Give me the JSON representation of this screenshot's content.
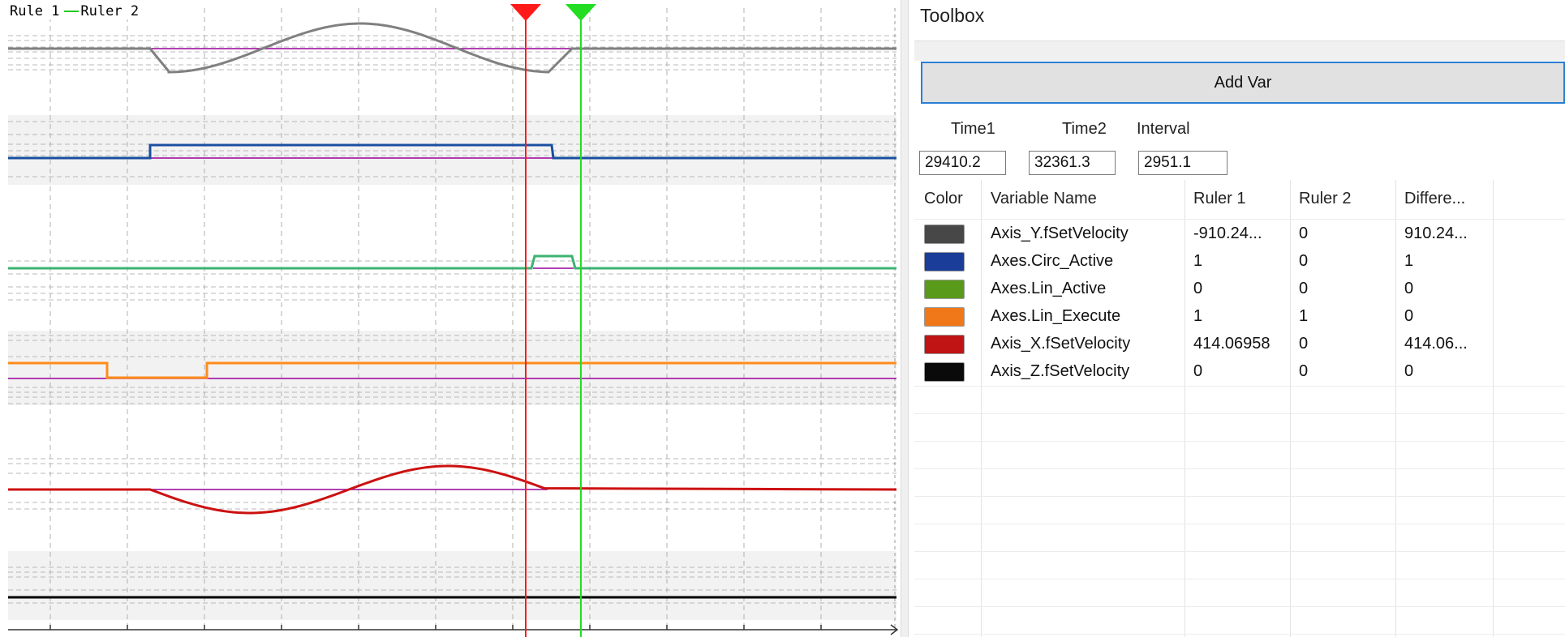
{
  "scope": {
    "legend": {
      "ruler1_label": "Rule 1",
      "ruler2_label": "Ruler 2"
    },
    "ruler1_color": "#ff1a1a",
    "ruler2_color": "#22dd22",
    "marker_color": "#990099",
    "trace_colors": [
      "#808080",
      "#1a4fa0",
      "#3cb371",
      "#ff8c1a",
      "#cc1111",
      "#000000"
    ]
  },
  "toolbox": {
    "title": "Toolbox",
    "add_var_label": "Add Var",
    "time1_label": "Time1",
    "time2_label": "Time2",
    "interval_label": "Interval",
    "time1_value": "29410.2",
    "time2_value": "32361.3",
    "interval_value": "2951.1",
    "columns": [
      "Color",
      "Variable Name",
      "Ruler 1",
      "Ruler 2",
      "Differe..."
    ],
    "rows": [
      {
        "color": "#474747",
        "name": "Axis_Y.fSetVelocity",
        "ruler1": "-910.24...",
        "ruler2": "0",
        "diff": "910.24..."
      },
      {
        "color": "#1a3d9a",
        "name": "Axes.Circ_Active",
        "ruler1": "1",
        "ruler2": "0",
        "diff": "1"
      },
      {
        "color": "#5a9a1a",
        "name": "Axes.Lin_Active",
        "ruler1": "0",
        "ruler2": "0",
        "diff": "0"
      },
      {
        "color": "#f07818",
        "name": "Axes.Lin_Execute",
        "ruler1": "1",
        "ruler2": "1",
        "diff": "0"
      },
      {
        "color": "#c01414",
        "name": "Axis_X.fSetVelocity",
        "ruler1": "414.06958",
        "ruler2": "0",
        "diff": "414.06..."
      },
      {
        "color": "#0a0a0a",
        "name": "Axis_Z.fSetVelocity",
        "ruler1": "0",
        "ruler2": "0",
        "diff": "0"
      }
    ]
  }
}
